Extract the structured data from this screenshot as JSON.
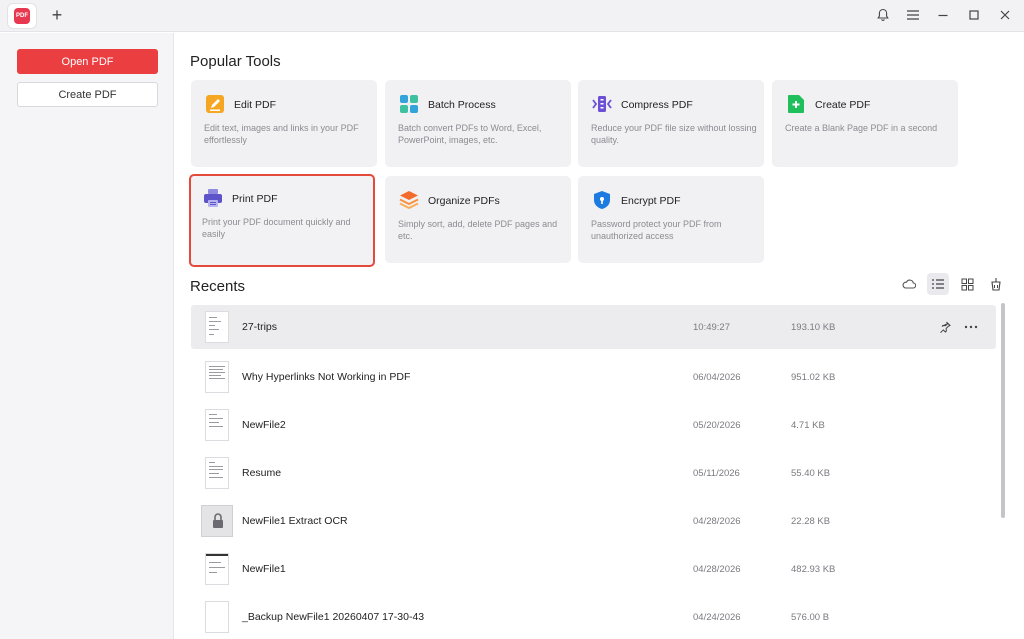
{
  "app": {
    "logo_text": "PDF",
    "new_tab_label": "+"
  },
  "window_controls": [
    "bell-icon",
    "menu-icon",
    "minimize-icon",
    "maximize-icon",
    "close-icon"
  ],
  "sidebar": {
    "open_label": "Open PDF",
    "create_label": "Create PDF"
  },
  "colors": {
    "accent": "#ea3e41",
    "selected_border": "#e44a3b",
    "card_bg": "#f1f1f3"
  },
  "popular": {
    "title": "Popular Tools",
    "tools": [
      {
        "name": "Edit PDF",
        "desc": "Edit text, images and links in your PDF effortlessly",
        "icon": "edit-icon"
      },
      {
        "name": "Batch Process",
        "desc": "Batch convert PDFs to Word, Excel, PowerPoint, images, etc.",
        "icon": "batch-icon"
      },
      {
        "name": "Compress PDF",
        "desc": "Reduce your PDF file size without lossing quality.",
        "icon": "compress-icon"
      },
      {
        "name": "Create PDF",
        "desc": "Create a Blank Page PDF in a second",
        "icon": "create-icon"
      },
      {
        "name": "Print PDF",
        "desc": "Print your PDF document quickly and easily",
        "icon": "print-icon"
      },
      {
        "name": "Organize PDFs",
        "desc": "Simply sort, add, delete PDF pages and etc.",
        "icon": "organize-icon"
      },
      {
        "name": "Encrypt PDF",
        "desc": "Password protect your PDF from unauthorized access",
        "icon": "encrypt-icon"
      }
    ]
  },
  "recents": {
    "title": "Recents",
    "view_options": [
      "cloud-icon",
      "list-view-icon",
      "grid-view-icon",
      "clear-icon"
    ],
    "files": [
      {
        "name": "27-trips",
        "date": "10:49:27",
        "size": "193.10 KB"
      },
      {
        "name": "Why Hyperlinks Not Working in PDF",
        "date": "06/04/2026",
        "size": "951.02 KB"
      },
      {
        "name": "NewFile2",
        "date": "05/20/2026",
        "size": "4.71 KB"
      },
      {
        "name": "Resume",
        "date": "05/11/2026",
        "size": "55.40 KB"
      },
      {
        "name": "NewFile1 Extract OCR",
        "date": "04/28/2026",
        "size": "22.28 KB"
      },
      {
        "name": "NewFile1",
        "date": "04/28/2026",
        "size": "482.93 KB"
      },
      {
        "name": "_Backup NewFile1 20260407 17-30-43",
        "date": "04/24/2026",
        "size": "576.00 B"
      }
    ]
  }
}
